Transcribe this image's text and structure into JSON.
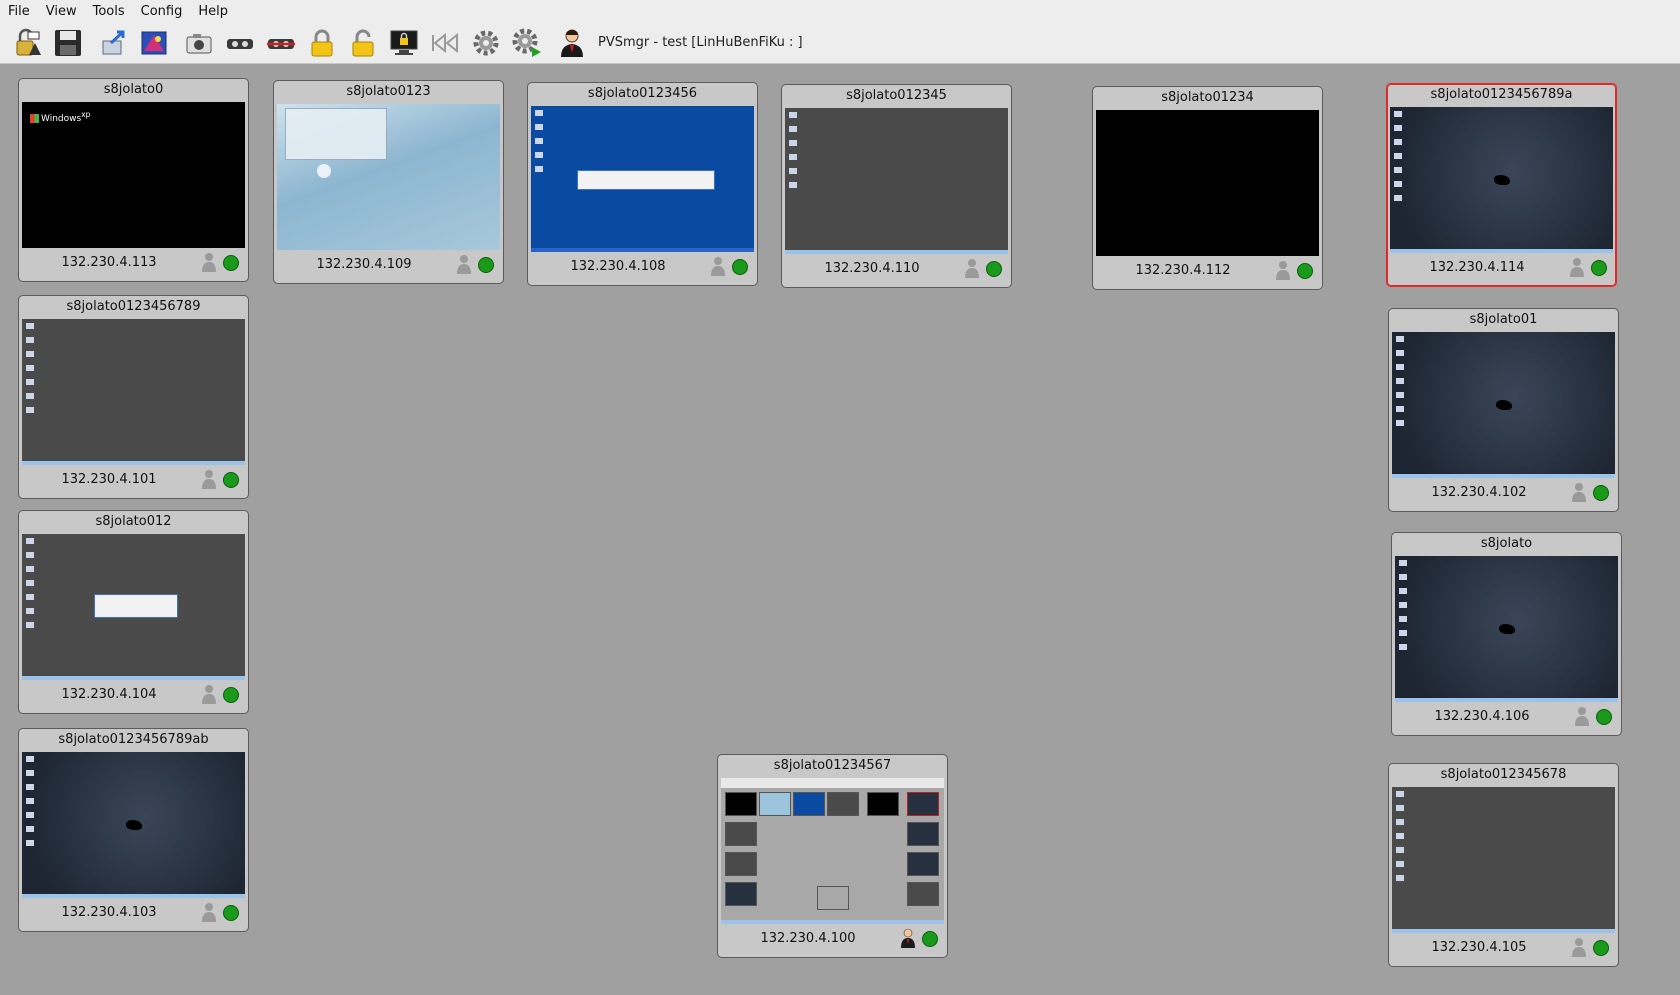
{
  "menubar": {
    "items": [
      {
        "label": "File"
      },
      {
        "label": "View"
      },
      {
        "label": "Tools"
      },
      {
        "label": "Config"
      },
      {
        "label": "Help"
      }
    ]
  },
  "toolbar": {
    "status_text": "PVSmgr - test [LinHuBenFiKu : ]",
    "buttons": [
      {
        "icon": "open-lock-icon"
      },
      {
        "icon": "save-icon"
      },
      {
        "icon": "send-file-icon"
      },
      {
        "icon": "projection-icon"
      },
      {
        "icon": "camera-icon"
      },
      {
        "icon": "projector-icon"
      },
      {
        "icon": "projector-stop-icon"
      },
      {
        "icon": "lock-icon"
      },
      {
        "icon": "unlock-icon"
      },
      {
        "icon": "monitor-lock-icon"
      },
      {
        "icon": "rewind-icon"
      },
      {
        "icon": "settings-gear-icon"
      },
      {
        "icon": "settings-run-icon"
      },
      {
        "icon": "tutor-user-icon"
      }
    ]
  },
  "clients": [
    {
      "name": "s8jolato0",
      "ip": "132.230.4.113",
      "screen": "winxp-black"
    },
    {
      "name": "s8jolato0123",
      "ip": "132.230.4.109",
      "screen": "kde-light"
    },
    {
      "name": "s8jolato0123456",
      "ip": "132.230.4.108",
      "screen": "win-blue"
    },
    {
      "name": "s8jolato012345",
      "ip": "132.230.4.110",
      "screen": "gray-desktop"
    },
    {
      "name": "s8jolato01234",
      "ip": "132.230.4.112",
      "screen": "black"
    },
    {
      "name": "s8jolato0123456789a",
      "ip": "132.230.4.114",
      "screen": "xfce",
      "selected": true
    },
    {
      "name": "s8jolato0123456789",
      "ip": "132.230.4.101",
      "screen": "gray-desktop"
    },
    {
      "name": "s8jolato01",
      "ip": "132.230.4.102",
      "screen": "xfce"
    },
    {
      "name": "s8jolato012",
      "ip": "132.230.4.104",
      "screen": "gray-dialog"
    },
    {
      "name": "s8jolato",
      "ip": "132.230.4.106",
      "screen": "xfce"
    },
    {
      "name": "s8jolato0123456789ab",
      "ip": "132.230.4.103",
      "screen": "xfce"
    },
    {
      "name": "s8jolato01234567",
      "ip": "132.230.4.100",
      "screen": "pvs-mirror",
      "tutor": true
    },
    {
      "name": "s8jolato012345678",
      "ip": "132.230.4.105",
      "screen": "gray-desktop"
    }
  ],
  "colors": {
    "online": "#1a9a1a",
    "selected_border": "#e02a2a",
    "workspace": "#a0a0a0"
  }
}
